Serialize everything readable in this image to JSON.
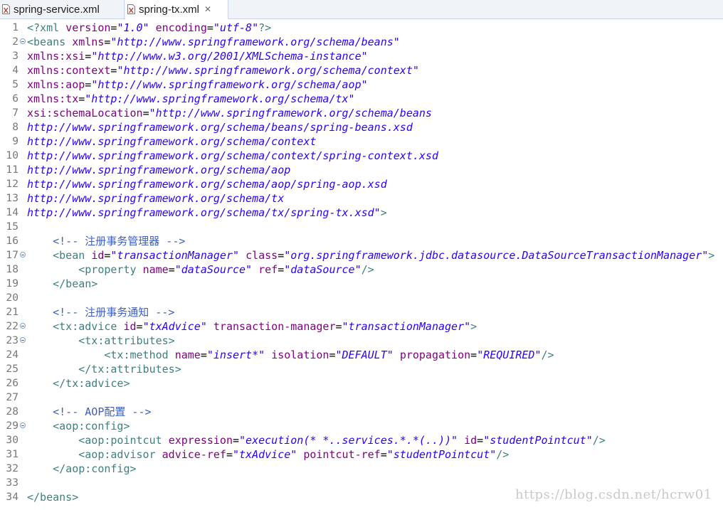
{
  "tabs": [
    {
      "label": "spring-service.xml",
      "active": false,
      "closable": false,
      "icon": "xml-file-icon"
    },
    {
      "label": "spring-tx.xml",
      "active": true,
      "closable": true,
      "close_glyph": "✕",
      "icon": "xml-file-icon"
    }
  ],
  "editor": {
    "lines": [
      {
        "n": "1",
        "fold": false,
        "tokens": [
          [
            "pi",
            "<?xml "
          ],
          [
            "attr",
            "version"
          ],
          [
            "plain",
            "="
          ],
          [
            "val",
            "\"1.0\""
          ],
          [
            "plain",
            " "
          ],
          [
            "attr",
            "encoding"
          ],
          [
            "plain",
            "="
          ],
          [
            "val",
            "\"utf-8\""
          ],
          [
            "pi",
            "?>"
          ]
        ]
      },
      {
        "n": "2",
        "fold": true,
        "tokens": [
          [
            "tag",
            "<beans "
          ],
          [
            "attr",
            "xmlns"
          ],
          [
            "plain",
            "="
          ],
          [
            "val",
            "\"http://www.springframework.org/schema/beans\""
          ]
        ]
      },
      {
        "n": "3",
        "fold": false,
        "tokens": [
          [
            "attr",
            "xmlns:xsi"
          ],
          [
            "plain",
            "="
          ],
          [
            "val",
            "\"http://www.w3.org/2001/XMLSchema-instance\""
          ]
        ]
      },
      {
        "n": "4",
        "fold": false,
        "tokens": [
          [
            "attr",
            "xmlns:context"
          ],
          [
            "plain",
            "="
          ],
          [
            "val",
            "\"http://www.springframework.org/schema/context\""
          ]
        ]
      },
      {
        "n": "5",
        "fold": false,
        "tokens": [
          [
            "attr",
            "xmlns:aop"
          ],
          [
            "plain",
            "="
          ],
          [
            "val",
            "\"http://www.springframework.org/schema/aop\""
          ]
        ]
      },
      {
        "n": "6",
        "fold": false,
        "tokens": [
          [
            "attr",
            "xmlns:tx"
          ],
          [
            "plain",
            "="
          ],
          [
            "val",
            "\"http://www.springframework.org/schema/tx\""
          ]
        ]
      },
      {
        "n": "7",
        "fold": false,
        "tokens": [
          [
            "attr",
            "xsi:schemaLocation"
          ],
          [
            "plain",
            "="
          ],
          [
            "val",
            "\"http://www.springframework.org/schema/beans"
          ]
        ]
      },
      {
        "n": "8",
        "fold": false,
        "tokens": [
          [
            "val",
            "http://www.springframework.org/schema/beans/spring-beans.xsd"
          ]
        ]
      },
      {
        "n": "9",
        "fold": false,
        "tokens": [
          [
            "val",
            "http://www.springframework.org/schema/context"
          ]
        ]
      },
      {
        "n": "10",
        "fold": false,
        "tokens": [
          [
            "val",
            "http://www.springframework.org/schema/context/spring-context.xsd"
          ]
        ]
      },
      {
        "n": "11",
        "fold": false,
        "tokens": [
          [
            "val",
            "http://www.springframework.org/schema/aop"
          ]
        ]
      },
      {
        "n": "12",
        "fold": false,
        "tokens": [
          [
            "val",
            "http://www.springframework.org/schema/aop/spring-aop.xsd"
          ]
        ]
      },
      {
        "n": "13",
        "fold": false,
        "tokens": [
          [
            "val",
            "http://www.springframework.org/schema/tx"
          ]
        ]
      },
      {
        "n": "14",
        "fold": false,
        "tokens": [
          [
            "val",
            "http://www.springframework.org/schema/tx/spring-tx.xsd\""
          ],
          [
            "tag",
            ">"
          ]
        ]
      },
      {
        "n": "15",
        "fold": false,
        "tokens": []
      },
      {
        "n": "16",
        "fold": false,
        "tokens": [
          [
            "plain",
            "    "
          ],
          [
            "com",
            "<!-- 注册事务管理器 -->"
          ]
        ]
      },
      {
        "n": "17",
        "fold": true,
        "tokens": [
          [
            "plain",
            "    "
          ],
          [
            "tag",
            "<bean "
          ],
          [
            "attr",
            "id"
          ],
          [
            "plain",
            "="
          ],
          [
            "val",
            "\"transactionManager\""
          ],
          [
            "plain",
            " "
          ],
          [
            "attr",
            "class"
          ],
          [
            "plain",
            "="
          ],
          [
            "val",
            "\"org.springframework.jdbc.datasource.DataSourceTransactionManager\""
          ],
          [
            "tag",
            ">"
          ]
        ]
      },
      {
        "n": "18",
        "fold": false,
        "tokens": [
          [
            "plain",
            "        "
          ],
          [
            "tag",
            "<property "
          ],
          [
            "attr",
            "name"
          ],
          [
            "plain",
            "="
          ],
          [
            "val",
            "\"dataSource\""
          ],
          [
            "plain",
            " "
          ],
          [
            "attr",
            "ref"
          ],
          [
            "plain",
            "="
          ],
          [
            "val",
            "\"dataSource\""
          ],
          [
            "tag",
            "/>"
          ]
        ]
      },
      {
        "n": "19",
        "fold": false,
        "tokens": [
          [
            "plain",
            "    "
          ],
          [
            "tag",
            "</bean>"
          ]
        ]
      },
      {
        "n": "20",
        "fold": false,
        "tokens": []
      },
      {
        "n": "21",
        "fold": false,
        "tokens": [
          [
            "plain",
            "    "
          ],
          [
            "com",
            "<!-- 注册事务通知 -->"
          ]
        ]
      },
      {
        "n": "22",
        "fold": true,
        "tokens": [
          [
            "plain",
            "    "
          ],
          [
            "tag",
            "<tx:advice "
          ],
          [
            "attr",
            "id"
          ],
          [
            "plain",
            "="
          ],
          [
            "val",
            "\"txAdvice\""
          ],
          [
            "plain",
            " "
          ],
          [
            "attr",
            "transaction-manager"
          ],
          [
            "plain",
            "="
          ],
          [
            "val",
            "\"transactionManager\""
          ],
          [
            "tag",
            ">"
          ]
        ]
      },
      {
        "n": "23",
        "fold": true,
        "tokens": [
          [
            "plain",
            "        "
          ],
          [
            "tag",
            "<tx:attributes>"
          ]
        ]
      },
      {
        "n": "24",
        "fold": false,
        "tokens": [
          [
            "plain",
            "            "
          ],
          [
            "tag",
            "<tx:method "
          ],
          [
            "attr",
            "name"
          ],
          [
            "plain",
            "="
          ],
          [
            "val",
            "\"insert*\""
          ],
          [
            "plain",
            " "
          ],
          [
            "attr",
            "isolation"
          ],
          [
            "plain",
            "="
          ],
          [
            "val",
            "\"DEFAULT\""
          ],
          [
            "plain",
            " "
          ],
          [
            "attr",
            "propagation"
          ],
          [
            "plain",
            "="
          ],
          [
            "val",
            "\"REQUIRED\""
          ],
          [
            "tag",
            "/>"
          ]
        ]
      },
      {
        "n": "25",
        "fold": false,
        "tokens": [
          [
            "plain",
            "        "
          ],
          [
            "tag",
            "</tx:attributes>"
          ]
        ]
      },
      {
        "n": "26",
        "fold": false,
        "tokens": [
          [
            "plain",
            "    "
          ],
          [
            "tag",
            "</tx:advice>"
          ]
        ]
      },
      {
        "n": "27",
        "fold": false,
        "tokens": []
      },
      {
        "n": "28",
        "fold": false,
        "tokens": [
          [
            "plain",
            "    "
          ],
          [
            "com",
            "<!-- AOP配置 -->"
          ]
        ]
      },
      {
        "n": "29",
        "fold": true,
        "tokens": [
          [
            "plain",
            "    "
          ],
          [
            "tag",
            "<aop:config>"
          ]
        ]
      },
      {
        "n": "30",
        "fold": false,
        "tokens": [
          [
            "plain",
            "        "
          ],
          [
            "tag",
            "<aop:pointcut "
          ],
          [
            "attr",
            "expression"
          ],
          [
            "plain",
            "="
          ],
          [
            "val",
            "\"execution(* *..services.*.*(..))\""
          ],
          [
            "plain",
            " "
          ],
          [
            "attr",
            "id"
          ],
          [
            "plain",
            "="
          ],
          [
            "val",
            "\"studentPointcut\""
          ],
          [
            "tag",
            "/>"
          ]
        ]
      },
      {
        "n": "31",
        "fold": false,
        "tokens": [
          [
            "plain",
            "        "
          ],
          [
            "tag",
            "<aop:advisor "
          ],
          [
            "attr",
            "advice-ref"
          ],
          [
            "plain",
            "="
          ],
          [
            "val",
            "\"txAdvice\""
          ],
          [
            "plain",
            " "
          ],
          [
            "attr",
            "pointcut-ref"
          ],
          [
            "plain",
            "="
          ],
          [
            "val",
            "\"studentPointcut\""
          ],
          [
            "tag",
            "/>"
          ]
        ]
      },
      {
        "n": "32",
        "fold": false,
        "tokens": [
          [
            "plain",
            "    "
          ],
          [
            "tag",
            "</aop:config>"
          ]
        ]
      },
      {
        "n": "33",
        "fold": false,
        "tokens": []
      },
      {
        "n": "34",
        "fold": false,
        "tokens": [
          [
            "tag",
            "</beans>"
          ]
        ]
      }
    ]
  },
  "colors": {
    "tag": "#3f7f7f",
    "attr": "#7f007f",
    "value": "#2a00ff",
    "comment": "#3f5fbf",
    "line_number": "#787878"
  },
  "watermark": "https://blog.csdn.net/hcrw01"
}
